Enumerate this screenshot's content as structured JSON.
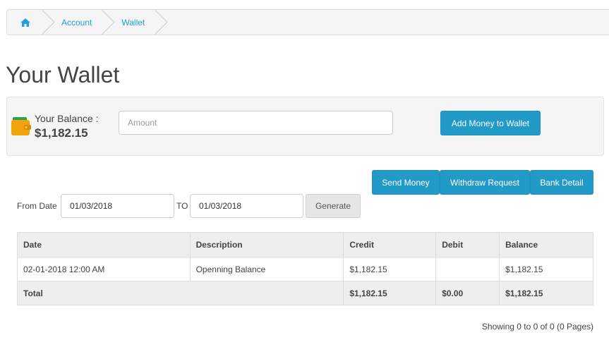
{
  "breadcrumb": {
    "home_icon": "home-icon",
    "items": [
      "Account",
      "Wallet"
    ]
  },
  "page": {
    "title": "Your Wallet"
  },
  "balance": {
    "label": "Your Balance :",
    "value": "$1,182.15",
    "icon": "wallet-icon",
    "amount_placeholder": "Amount",
    "add_button": "Add Money to Wallet"
  },
  "actions": {
    "send_money": "Send Money",
    "withdraw": "Withdraw Request",
    "bank_detail": "Bank Detail"
  },
  "filter": {
    "from_label": "From Date",
    "from_value": "01/03/2018",
    "to_label": "TO",
    "to_value": "01/03/2018",
    "generate": "Generate"
  },
  "table": {
    "headers": [
      "Date",
      "Description",
      "Credit",
      "Debit",
      "Balance"
    ],
    "rows": [
      [
        "02-01-2018 12:00 AM",
        "Openning Balance",
        "$1,182.15",
        "",
        "$1,182.15"
      ]
    ],
    "total": {
      "label": "Total",
      "credit": "$1,182.15",
      "debit": "$0.00",
      "balance": "$1,182.15"
    }
  },
  "pager": {
    "info": "Showing 0 to 0 of 0 (0 Pages)"
  },
  "colors": {
    "primary": "#229ac8",
    "link": "#23a1d1",
    "wallet_orange": "#f0a30a"
  }
}
